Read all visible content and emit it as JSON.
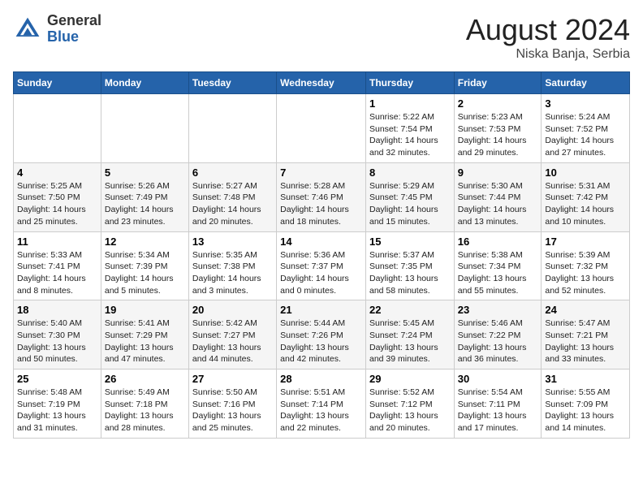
{
  "header": {
    "logo_general": "General",
    "logo_blue": "Blue",
    "month_title": "August 2024",
    "location": "Niska Banja, Serbia"
  },
  "weekdays": [
    "Sunday",
    "Monday",
    "Tuesday",
    "Wednesday",
    "Thursday",
    "Friday",
    "Saturday"
  ],
  "weeks": [
    [
      {
        "day": "",
        "info": ""
      },
      {
        "day": "",
        "info": ""
      },
      {
        "day": "",
        "info": ""
      },
      {
        "day": "",
        "info": ""
      },
      {
        "day": "1",
        "info": "Sunrise: 5:22 AM\nSunset: 7:54 PM\nDaylight: 14 hours\nand 32 minutes."
      },
      {
        "day": "2",
        "info": "Sunrise: 5:23 AM\nSunset: 7:53 PM\nDaylight: 14 hours\nand 29 minutes."
      },
      {
        "day": "3",
        "info": "Sunrise: 5:24 AM\nSunset: 7:52 PM\nDaylight: 14 hours\nand 27 minutes."
      }
    ],
    [
      {
        "day": "4",
        "info": "Sunrise: 5:25 AM\nSunset: 7:50 PM\nDaylight: 14 hours\nand 25 minutes."
      },
      {
        "day": "5",
        "info": "Sunrise: 5:26 AM\nSunset: 7:49 PM\nDaylight: 14 hours\nand 23 minutes."
      },
      {
        "day": "6",
        "info": "Sunrise: 5:27 AM\nSunset: 7:48 PM\nDaylight: 14 hours\nand 20 minutes."
      },
      {
        "day": "7",
        "info": "Sunrise: 5:28 AM\nSunset: 7:46 PM\nDaylight: 14 hours\nand 18 minutes."
      },
      {
        "day": "8",
        "info": "Sunrise: 5:29 AM\nSunset: 7:45 PM\nDaylight: 14 hours\nand 15 minutes."
      },
      {
        "day": "9",
        "info": "Sunrise: 5:30 AM\nSunset: 7:44 PM\nDaylight: 14 hours\nand 13 minutes."
      },
      {
        "day": "10",
        "info": "Sunrise: 5:31 AM\nSunset: 7:42 PM\nDaylight: 14 hours\nand 10 minutes."
      }
    ],
    [
      {
        "day": "11",
        "info": "Sunrise: 5:33 AM\nSunset: 7:41 PM\nDaylight: 14 hours\nand 8 minutes."
      },
      {
        "day": "12",
        "info": "Sunrise: 5:34 AM\nSunset: 7:39 PM\nDaylight: 14 hours\nand 5 minutes."
      },
      {
        "day": "13",
        "info": "Sunrise: 5:35 AM\nSunset: 7:38 PM\nDaylight: 14 hours\nand 3 minutes."
      },
      {
        "day": "14",
        "info": "Sunrise: 5:36 AM\nSunset: 7:37 PM\nDaylight: 14 hours\nand 0 minutes."
      },
      {
        "day": "15",
        "info": "Sunrise: 5:37 AM\nSunset: 7:35 PM\nDaylight: 13 hours\nand 58 minutes."
      },
      {
        "day": "16",
        "info": "Sunrise: 5:38 AM\nSunset: 7:34 PM\nDaylight: 13 hours\nand 55 minutes."
      },
      {
        "day": "17",
        "info": "Sunrise: 5:39 AM\nSunset: 7:32 PM\nDaylight: 13 hours\nand 52 minutes."
      }
    ],
    [
      {
        "day": "18",
        "info": "Sunrise: 5:40 AM\nSunset: 7:30 PM\nDaylight: 13 hours\nand 50 minutes."
      },
      {
        "day": "19",
        "info": "Sunrise: 5:41 AM\nSunset: 7:29 PM\nDaylight: 13 hours\nand 47 minutes."
      },
      {
        "day": "20",
        "info": "Sunrise: 5:42 AM\nSunset: 7:27 PM\nDaylight: 13 hours\nand 44 minutes."
      },
      {
        "day": "21",
        "info": "Sunrise: 5:44 AM\nSunset: 7:26 PM\nDaylight: 13 hours\nand 42 minutes."
      },
      {
        "day": "22",
        "info": "Sunrise: 5:45 AM\nSunset: 7:24 PM\nDaylight: 13 hours\nand 39 minutes."
      },
      {
        "day": "23",
        "info": "Sunrise: 5:46 AM\nSunset: 7:22 PM\nDaylight: 13 hours\nand 36 minutes."
      },
      {
        "day": "24",
        "info": "Sunrise: 5:47 AM\nSunset: 7:21 PM\nDaylight: 13 hours\nand 33 minutes."
      }
    ],
    [
      {
        "day": "25",
        "info": "Sunrise: 5:48 AM\nSunset: 7:19 PM\nDaylight: 13 hours\nand 31 minutes."
      },
      {
        "day": "26",
        "info": "Sunrise: 5:49 AM\nSunset: 7:18 PM\nDaylight: 13 hours\nand 28 minutes."
      },
      {
        "day": "27",
        "info": "Sunrise: 5:50 AM\nSunset: 7:16 PM\nDaylight: 13 hours\nand 25 minutes."
      },
      {
        "day": "28",
        "info": "Sunrise: 5:51 AM\nSunset: 7:14 PM\nDaylight: 13 hours\nand 22 minutes."
      },
      {
        "day": "29",
        "info": "Sunrise: 5:52 AM\nSunset: 7:12 PM\nDaylight: 13 hours\nand 20 minutes."
      },
      {
        "day": "30",
        "info": "Sunrise: 5:54 AM\nSunset: 7:11 PM\nDaylight: 13 hours\nand 17 minutes."
      },
      {
        "day": "31",
        "info": "Sunrise: 5:55 AM\nSunset: 7:09 PM\nDaylight: 13 hours\nand 14 minutes."
      }
    ]
  ]
}
